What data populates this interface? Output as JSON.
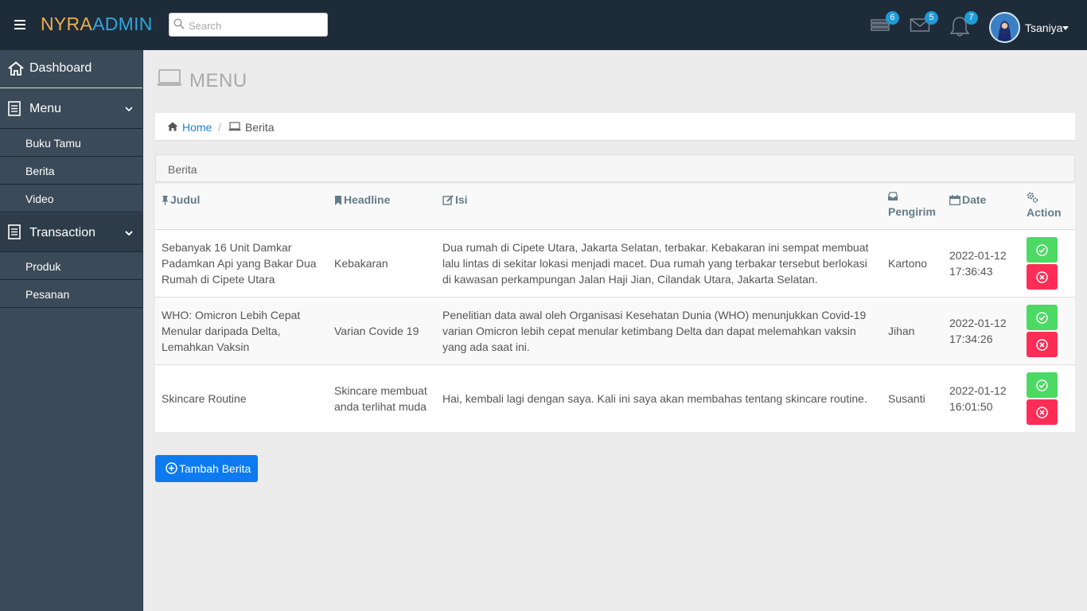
{
  "brand": {
    "part1": "NYRA",
    "part2": "ADMIN"
  },
  "search": {
    "placeholder": "Search",
    "value": ""
  },
  "nav": {
    "tasks_count": "6",
    "messages_count": "5",
    "notifications_count": "7",
    "user_name": "Tsaniya"
  },
  "sidebar": {
    "dashboard": "Dashboard",
    "menu": "Menu",
    "menu_items": [
      "Buku Tamu",
      "Berita",
      "Video"
    ],
    "transaction": "Transaction",
    "transaction_items": [
      "Produk",
      "Pesanan"
    ]
  },
  "page": {
    "title": "MENU",
    "breadcrumb": {
      "home": "Home",
      "separator": "/",
      "current": "Berita"
    },
    "panel_title": "Berita"
  },
  "table": {
    "columns": {
      "judul": "Judul",
      "headline": "Headline",
      "isi": "Isi",
      "pengirim": "Pengirim",
      "date": "Date",
      "action": "Action"
    },
    "rows": [
      {
        "judul": "Sebanyak 16 Unit Damkar Padamkan Api yang Bakar Dua Rumah di Cipete Utara",
        "headline": "Kebakaran",
        "isi": "Dua rumah di Cipete Utara, Jakarta Selatan, terbakar. Kebakaran ini sempat membuat lalu lintas di sekitar lokasi menjadi macet. Dua rumah yang terbakar tersebut berlokasi di kawasan perkampungan Jalan Haji Jian, Cilandak Utara, Jakarta Selatan.",
        "pengirim": "Kartono",
        "date": "2022-01-12 17:36:43"
      },
      {
        "judul": "WHO: Omicron Lebih Cepat Menular daripada Delta, Lemahkan Vaksin",
        "headline": "Varian Covide 19",
        "isi": "Penelitian data awal oleh Organisasi Kesehatan Dunia (WHO) menunjukkan Covid-19 varian Omicron lebih cepat menular ketimbang Delta dan dapat melemahkan vaksin yang ada saat ini.",
        "pengirim": "Jihan",
        "date": "2022-01-12 17:34:26"
      },
      {
        "judul": "Skincare Routine",
        "headline": "Skincare membuat anda terlihat muda",
        "isi": "Hai, kembali lagi dengan saya. Kali ini saya akan membahas tentang skincare routine.",
        "pengirim": "Susanti",
        "date": "2022-01-12 16:01:50"
      }
    ]
  },
  "add_button": "Tambah Berita",
  "colors": {
    "topbar": "#1e2b38",
    "sidebar": "#3b4a58",
    "accent_blue": "#0d7af0",
    "brand_orange": "#f0ad4e",
    "brand_blue": "#29a8e0",
    "approve_green": "#4cd964",
    "delete_red": "#ff2d55"
  },
  "icons": [
    "hamburger-icon",
    "search-icon",
    "tasks-icon",
    "envelope-icon",
    "bell-icon",
    "home-icon",
    "document-icon",
    "chevron-down-icon",
    "laptop-icon",
    "pin-icon",
    "bookmark-icon",
    "edit-icon",
    "inbox-icon",
    "calendar-icon",
    "gears-icon",
    "check-circle-icon",
    "times-circle-icon",
    "plus-circle-icon"
  ]
}
